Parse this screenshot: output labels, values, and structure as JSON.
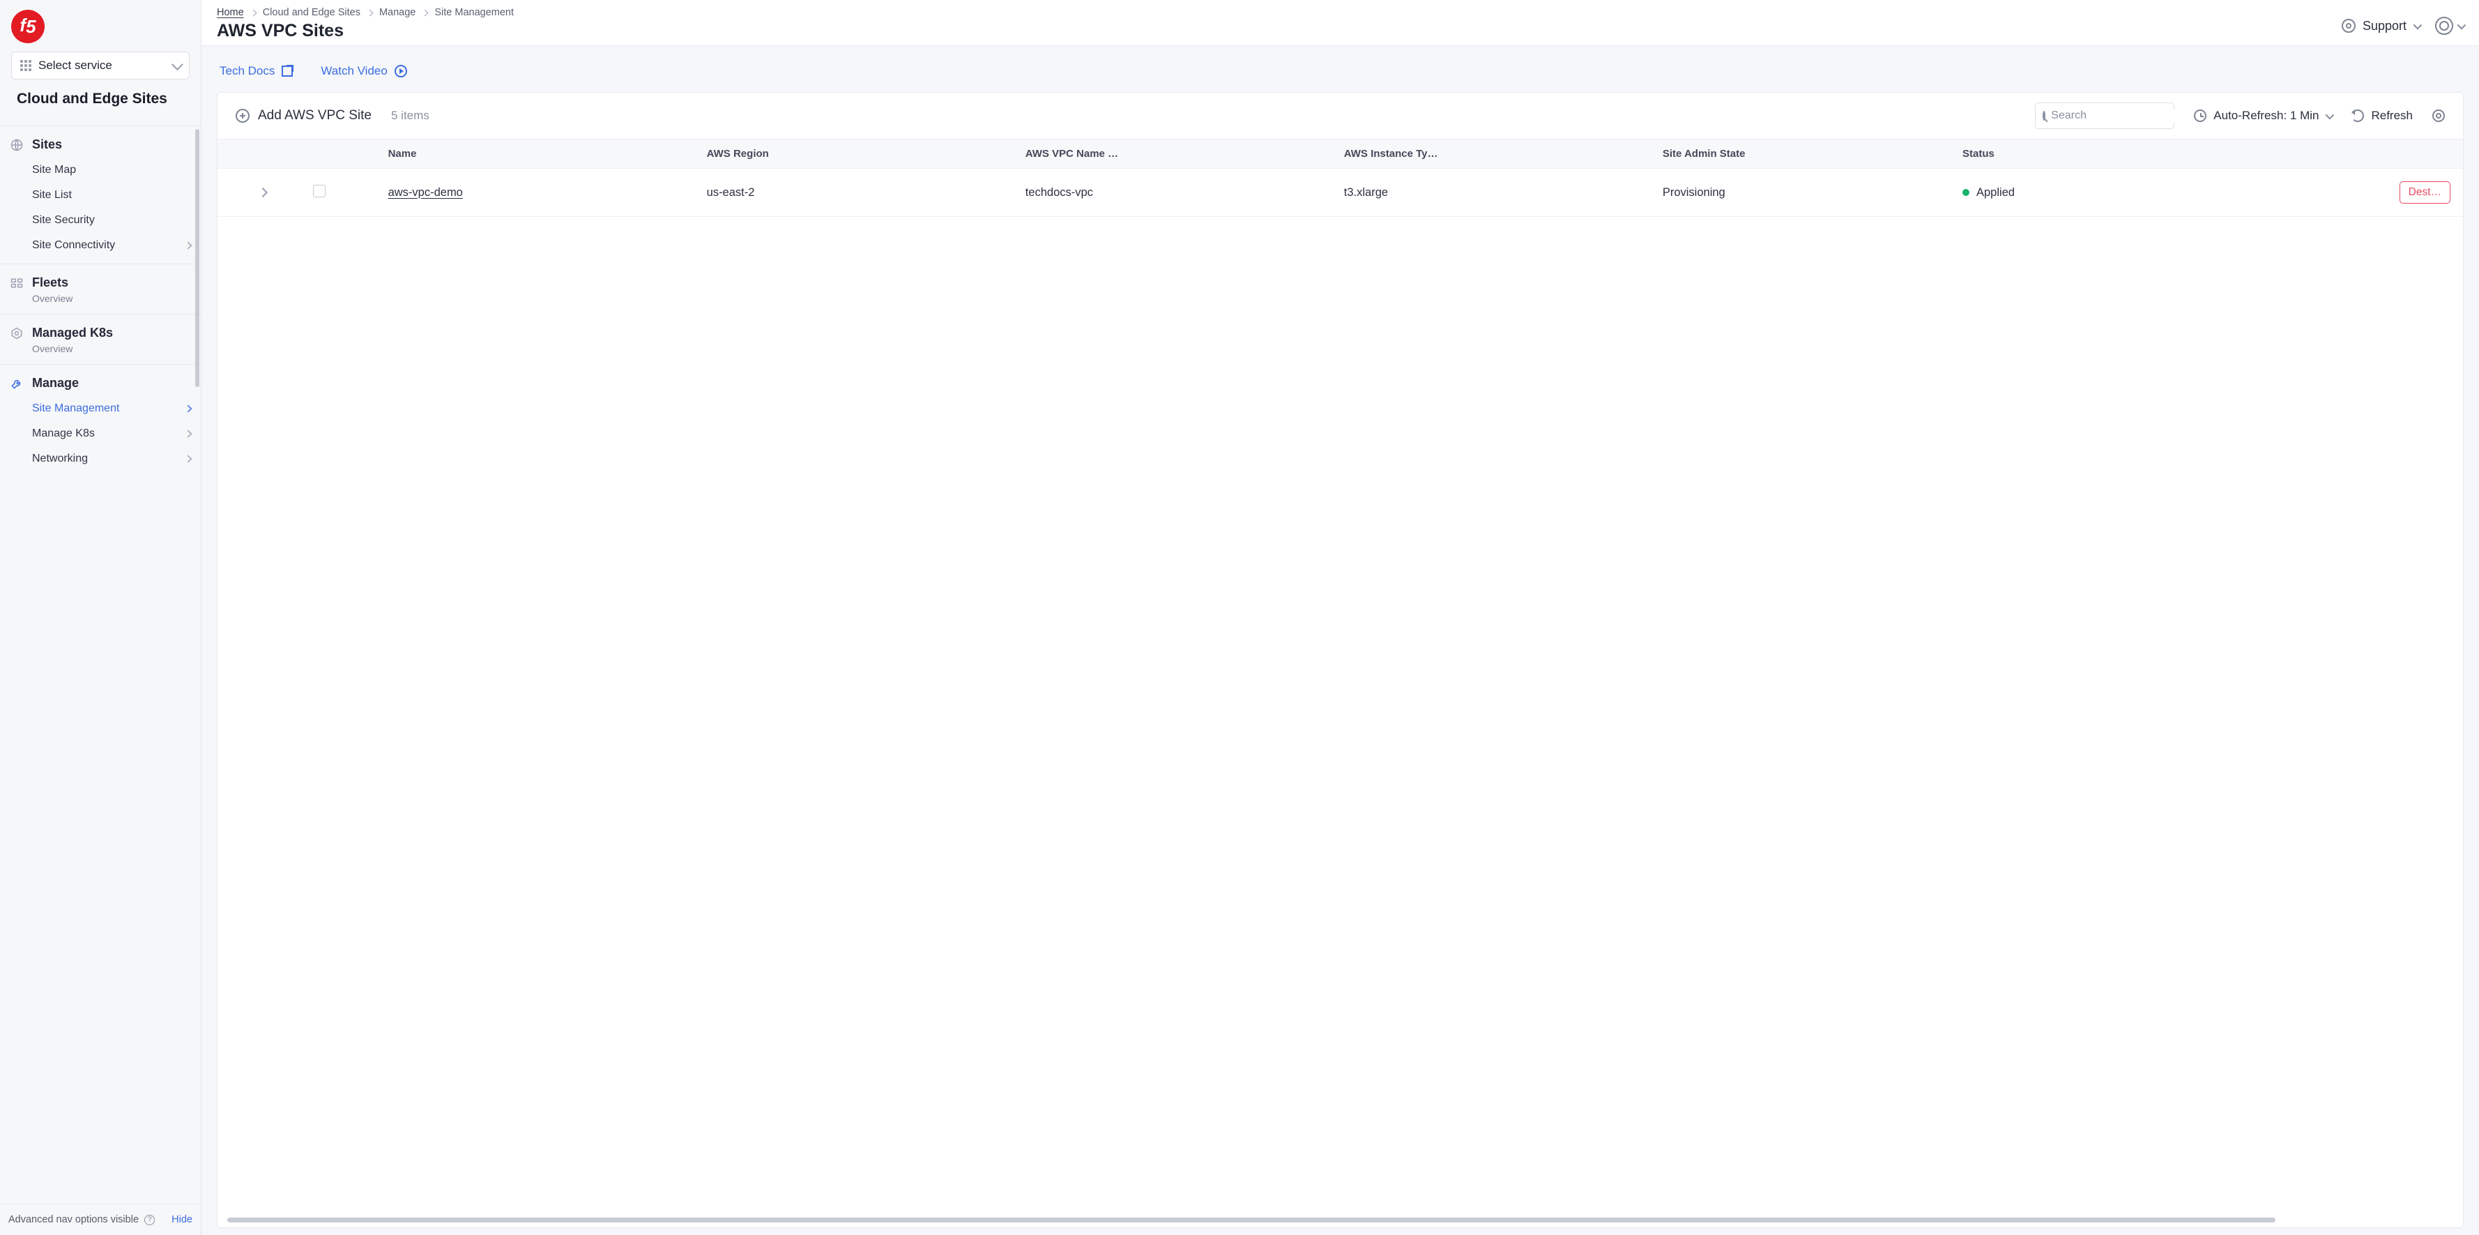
{
  "sidebar": {
    "service_select_label": "Select service",
    "section_title": "Cloud and Edge Sites",
    "groups": {
      "sites": {
        "label": "Sites",
        "items": [
          "Site Map",
          "Site List",
          "Site Security",
          "Site Connectivity"
        ]
      },
      "fleets": {
        "label": "Fleets",
        "subtitle": "Overview"
      },
      "k8s": {
        "label": "Managed K8s",
        "subtitle": "Overview"
      },
      "manage": {
        "label": "Manage",
        "items": [
          "Site Management",
          "Manage K8s",
          "Networking"
        ]
      }
    },
    "footer_text": "Advanced nav options visible",
    "footer_hide": "Hide"
  },
  "header": {
    "breadcrumbs": [
      "Home",
      "Cloud and Edge Sites",
      "Manage",
      "Site Management"
    ],
    "title": "AWS VPC Sites",
    "support_label": "Support"
  },
  "quicklinks": {
    "docs": "Tech Docs",
    "video": "Watch Video"
  },
  "toolbar": {
    "add_label": "Add AWS VPC Site",
    "count_label": "5 items",
    "search_placeholder": "Search",
    "autorefresh_label": "Auto-Refresh: 1 Min",
    "refresh_label": "Refresh"
  },
  "table": {
    "columns": [
      "Name",
      "AWS Region",
      "AWS VPC Name …",
      "AWS Instance Ty…",
      "Site Admin State",
      "Status"
    ],
    "rows": [
      {
        "name": "aws-vpc-demo",
        "region": "us-east-2",
        "vpc": "techdocs-vpc",
        "instance": "t3.xlarge",
        "admin_state": "Provisioning",
        "status": "Applied",
        "status_color": "green",
        "action": "Dest…"
      }
    ]
  }
}
